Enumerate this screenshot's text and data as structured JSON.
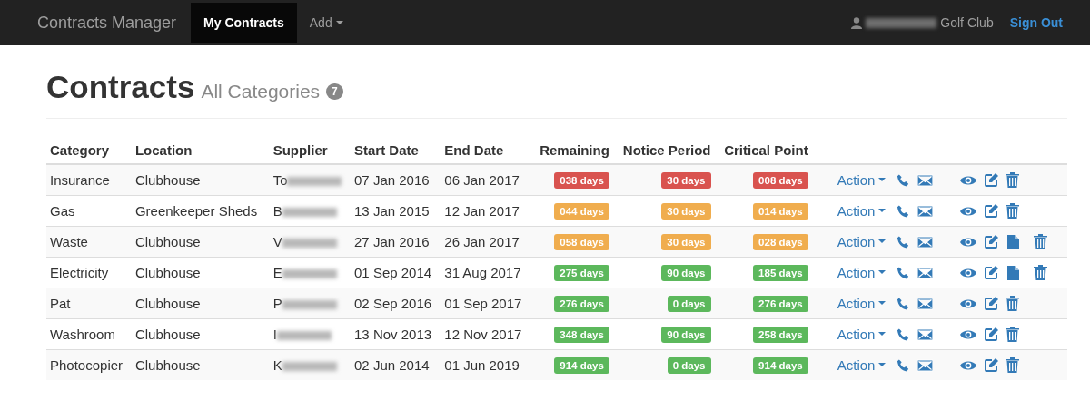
{
  "navbar": {
    "brand": "Contracts Manager",
    "tabs": [
      {
        "label": "My Contracts",
        "selected": true,
        "dropdown": false
      },
      {
        "label": "Add",
        "selected": false,
        "dropdown": true
      }
    ],
    "user": "Golf Club",
    "sign_out": "Sign Out"
  },
  "header": {
    "title": "Contracts",
    "subtitle": "All Categories",
    "count": "7"
  },
  "table": {
    "columns": [
      "Category",
      "Location",
      "Supplier",
      "Start Date",
      "End Date",
      "Remaining",
      "Notice Period",
      "Critical Point"
    ],
    "rows": [
      {
        "category": "Insurance",
        "location": "Clubhouse",
        "supplier": "To",
        "start": "07 Jan 2016",
        "end": "06 Jan 2017",
        "remaining": {
          "text": "038 days",
          "color": "#d9534f"
        },
        "notice": {
          "text": "30 days",
          "color": "#d9534f"
        },
        "critical": {
          "text": "008 days",
          "color": "#d9534f"
        },
        "action": "Action",
        "document": false
      },
      {
        "category": "Gas",
        "location": "Greenkeeper Sheds",
        "supplier": "B",
        "start": "13 Jan 2015",
        "end": "12 Jan 2017",
        "remaining": {
          "text": "044 days",
          "color": "#f0ad4e"
        },
        "notice": {
          "text": "30 days",
          "color": "#f0ad4e"
        },
        "critical": {
          "text": "014 days",
          "color": "#f0ad4e"
        },
        "action": "Action",
        "document": false
      },
      {
        "category": "Waste",
        "location": "Clubhouse",
        "supplier": "V",
        "start": "27 Jan 2016",
        "end": "26 Jan 2017",
        "remaining": {
          "text": "058 days",
          "color": "#f0ad4e"
        },
        "notice": {
          "text": "30 days",
          "color": "#f0ad4e"
        },
        "critical": {
          "text": "028 days",
          "color": "#f0ad4e"
        },
        "action": "Action",
        "document": true
      },
      {
        "category": "Electricity",
        "location": "Clubhouse",
        "supplier": "E",
        "start": "01 Sep 2014",
        "end": "31 Aug 2017",
        "remaining": {
          "text": "275 days",
          "color": "#5cb85c"
        },
        "notice": {
          "text": "90 days",
          "color": "#5cb85c"
        },
        "critical": {
          "text": "185 days",
          "color": "#5cb85c"
        },
        "action": "Action",
        "document": true
      },
      {
        "category": "Pat",
        "location": "Clubhouse",
        "supplier": "P",
        "start": "02 Sep 2016",
        "end": "01 Sep 2017",
        "remaining": {
          "text": "276 days",
          "color": "#5cb85c"
        },
        "notice": {
          "text": "0 days",
          "color": "#5cb85c"
        },
        "critical": {
          "text": "276 days",
          "color": "#5cb85c"
        },
        "action": "Action",
        "document": false
      },
      {
        "category": "Washroom",
        "location": "Clubhouse",
        "supplier": "I",
        "start": "13 Nov 2013",
        "end": "12 Nov 2017",
        "remaining": {
          "text": "348 days",
          "color": "#5cb85c"
        },
        "notice": {
          "text": "90 days",
          "color": "#5cb85c"
        },
        "critical": {
          "text": "258 days",
          "color": "#5cb85c"
        },
        "action": "Action",
        "document": false
      },
      {
        "category": "Photocopier",
        "location": "Clubhouse",
        "supplier": "K",
        "start": "02 Jun 2014",
        "end": "01 Jun 2019",
        "remaining": {
          "text": "914 days",
          "color": "#5cb85c"
        },
        "notice": {
          "text": "0 days",
          "color": "#5cb85c"
        },
        "critical": {
          "text": "914 days",
          "color": "#5cb85c"
        },
        "action": "Action",
        "document": false
      }
    ]
  }
}
